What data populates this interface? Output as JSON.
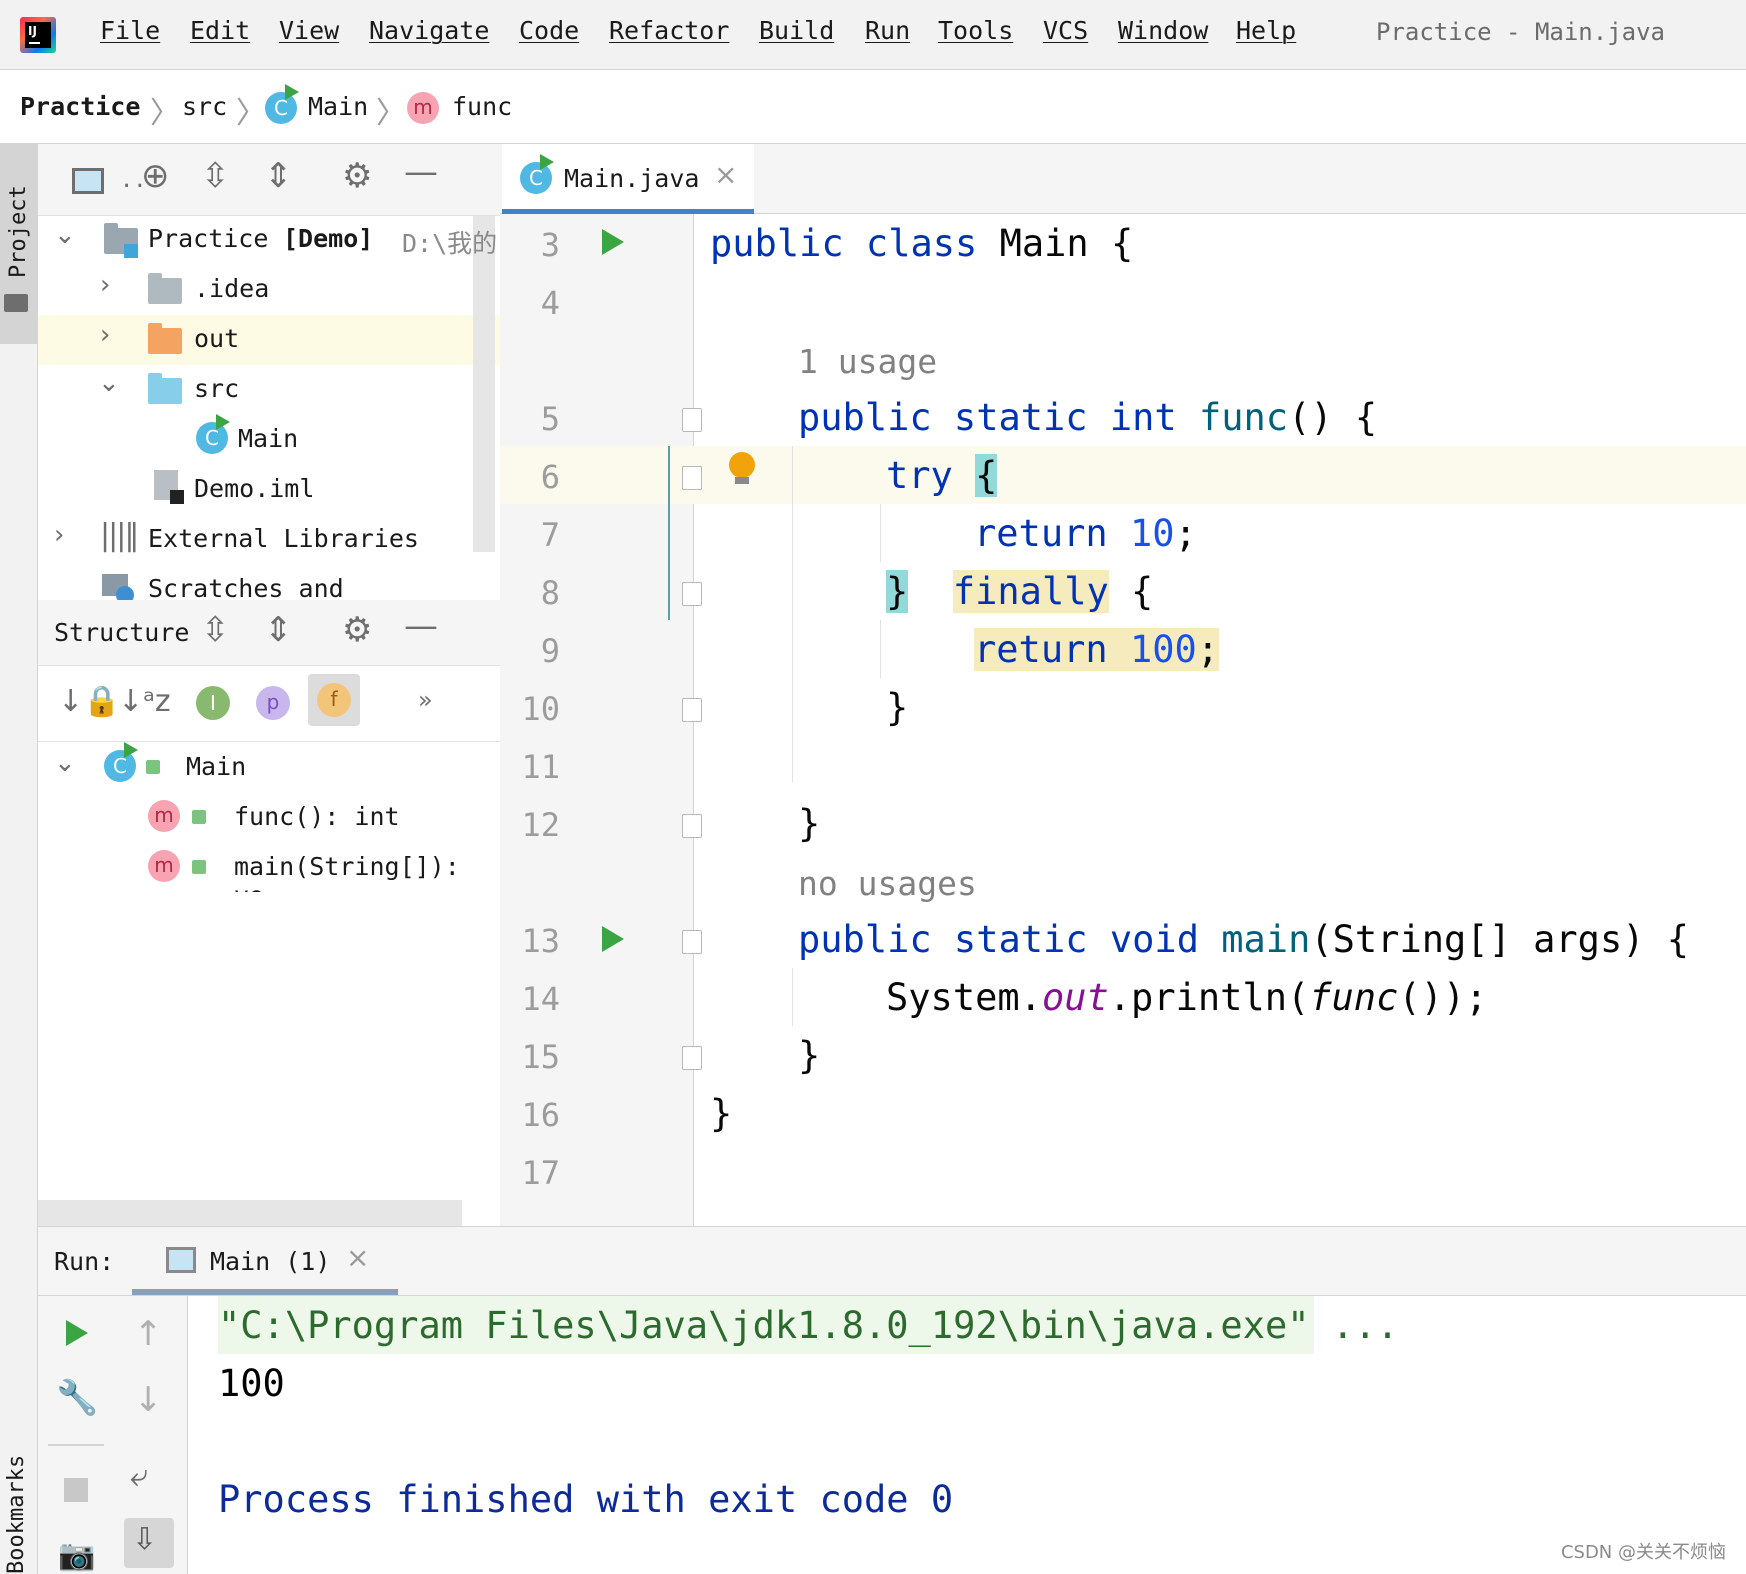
{
  "menubar": {
    "items": [
      "File",
      "Edit",
      "View",
      "Navigate",
      "Code",
      "Refactor",
      "Build",
      "Run",
      "Tools",
      "VCS",
      "Window",
      "Help"
    ],
    "window_title": "Practice - Main.java"
  },
  "breadcrumb": {
    "project": "Practice",
    "folder": "src",
    "class_name": "Main",
    "method": "func"
  },
  "left_stripe": {
    "project_tab": "Project",
    "bookmarks_tab": "Bookmarks"
  },
  "project_tree": {
    "root_name": "Practice",
    "root_module": "[Demo]",
    "root_path": "D:\\我的",
    "idea": ".idea",
    "out": "out",
    "src": "src",
    "main": "Main",
    "iml": "Demo.iml",
    "external": "External Libraries",
    "scratches": "Scratches and Consoles"
  },
  "structure": {
    "title": "Structure",
    "overflow": "»",
    "main": "Main",
    "func": "func(): int",
    "main_method": "main(String[]): vo"
  },
  "editor": {
    "tab_label": "Main.java",
    "line_numbers": [
      "3",
      "4",
      "5",
      "6",
      "7",
      "8",
      "9",
      "10",
      "11",
      "12",
      "13",
      "14",
      "15",
      "16",
      "17"
    ],
    "hint_usage": "1 usage",
    "hint_no_usages": "no usages",
    "code": {
      "l3_kw": "public class ",
      "l3_name": "Main",
      "l3_brace": " {",
      "l5_kw": "public static int ",
      "l5_fn": "func",
      "l5_rest": "() {",
      "l6_kw": "try ",
      "l6_brace": "{",
      "l7_kw": "return ",
      "l7_num": "10",
      "l7_end": ";",
      "l8_brace": "}",
      "l8_kw": "finally",
      "l8_rest": " {",
      "l9_kw": "return ",
      "l9_num": "100",
      "l9_end": ";",
      "l10": "}",
      "l12": "}",
      "l13_kw": "public static void ",
      "l13_fn": "main",
      "l13_rest": "(String[] args) {",
      "l14_a": "System.",
      "l14_field": "out",
      "l14_b": ".println(",
      "l14_call": "func",
      "l14_c": "());",
      "l15": "}",
      "l16": "}"
    }
  },
  "run": {
    "label": "Run:",
    "tab": "Main (1)",
    "cmd": "\"C:\\Program Files\\Java\\jdk1.8.0_192\\bin\\java.exe\" ...",
    "output": "100",
    "exit": "Process finished with exit code 0"
  },
  "watermark": "CSDN @关关不烦恼"
}
